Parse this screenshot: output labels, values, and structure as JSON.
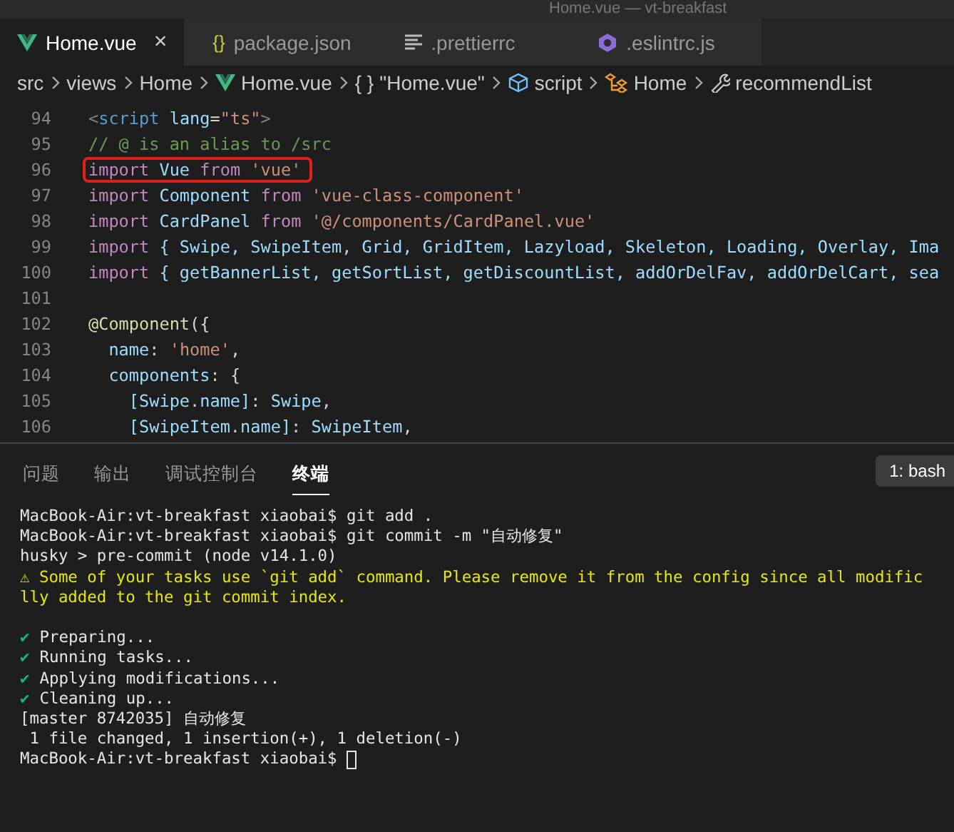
{
  "window": {
    "title": "Home.vue — vt-breakfast"
  },
  "tabs": [
    {
      "label": "Home.vue",
      "kind": "vue",
      "selected": true,
      "closable": true
    },
    {
      "label": "package.json",
      "kind": "json",
      "glyph": "{}",
      "selected": false
    },
    {
      "label": ".prettierrc",
      "kind": "lines",
      "selected": false
    },
    {
      "label": ".eslintrc.js",
      "kind": "eslint",
      "selected": false
    }
  ],
  "close_glyph": "×",
  "breadcrumb": [
    {
      "label": "src",
      "kind": "plain"
    },
    {
      "label": "views",
      "kind": "plain"
    },
    {
      "label": "Home",
      "kind": "plain"
    },
    {
      "label": "Home.vue",
      "kind": "vue"
    },
    {
      "label": "\"Home.vue\"",
      "kind": "braces",
      "glyph": "{ }"
    },
    {
      "label": "script",
      "kind": "cube"
    },
    {
      "label": "Home",
      "kind": "class"
    },
    {
      "label": "recommendList",
      "kind": "wrench"
    }
  ],
  "editor": {
    "lines": [
      {
        "number": "94",
        "tokens": [
          {
            "t": "<",
            "kind": "punct"
          },
          {
            "t": "script",
            "kind": "tag"
          },
          {
            "t": " lang",
            "kind": "attr"
          },
          {
            "t": "=",
            "kind": "plain"
          },
          {
            "t": "\"ts\"",
            "kind": "string"
          },
          {
            "t": ">",
            "kind": "punct"
          }
        ]
      },
      {
        "number": "95",
        "tokens": [
          {
            "t": "// @ is an alias to /src",
            "kind": "comment"
          }
        ]
      },
      {
        "number": "96",
        "highlighted": true,
        "tokens": [
          {
            "t": "import",
            "kind": "keyword"
          },
          {
            "t": " Vue ",
            "kind": "ident"
          },
          {
            "t": "from",
            "kind": "keyword"
          },
          {
            "t": " 'vue'",
            "kind": "string"
          }
        ]
      },
      {
        "number": "97",
        "tokens": [
          {
            "t": "import",
            "kind": "keyword"
          },
          {
            "t": " Component ",
            "kind": "ident"
          },
          {
            "t": "from",
            "kind": "keyword"
          },
          {
            "t": " 'vue-class-component'",
            "kind": "string"
          }
        ]
      },
      {
        "number": "98",
        "tokens": [
          {
            "t": "import",
            "kind": "keyword"
          },
          {
            "t": " CardPanel ",
            "kind": "ident"
          },
          {
            "t": "from",
            "kind": "keyword"
          },
          {
            "t": " '@/components/CardPanel.vue'",
            "kind": "string"
          }
        ]
      },
      {
        "number": "99",
        "tokens": [
          {
            "t": "import",
            "kind": "keyword"
          },
          {
            "t": " { Swipe, SwipeItem, Grid, GridItem, Lazyload, Skeleton, Loading, Overlay, Ima",
            "kind": "ident"
          }
        ]
      },
      {
        "number": "100",
        "tokens": [
          {
            "t": "import",
            "kind": "keyword"
          },
          {
            "t": " { getBannerList, getSortList, getDiscountList, addOrDelFav, addOrDelCart, sea",
            "kind": "ident"
          }
        ]
      },
      {
        "number": "101"
      },
      {
        "number": "102",
        "tokens": [
          {
            "t": "@Component",
            "kind": "decorator"
          },
          {
            "t": "({",
            "kind": "plain"
          }
        ]
      },
      {
        "number": "103",
        "tokens": [
          {
            "t": "  name",
            "kind": "ident"
          },
          {
            "t": ": ",
            "kind": "plain"
          },
          {
            "t": "'home'",
            "kind": "string"
          },
          {
            "t": ",",
            "kind": "plain"
          }
        ]
      },
      {
        "number": "104",
        "tokens": [
          {
            "t": "  components",
            "kind": "ident"
          },
          {
            "t": ": {",
            "kind": "plain"
          }
        ]
      },
      {
        "number": "105",
        "tokens": [
          {
            "t": "    [Swipe.name]",
            "kind": "ident"
          },
          {
            "t": ": ",
            "kind": "plain"
          },
          {
            "t": "Swipe",
            "kind": "ident"
          },
          {
            "t": ",",
            "kind": "plain"
          }
        ]
      },
      {
        "number": "106",
        "tokens": [
          {
            "t": "    [SwipeItem.name]",
            "kind": "ident"
          },
          {
            "t": ": ",
            "kind": "plain"
          },
          {
            "t": "SwipeItem",
            "kind": "ident"
          },
          {
            "t": ",",
            "kind": "plain"
          }
        ]
      }
    ]
  },
  "panel": {
    "tabs": [
      {
        "label": "问题",
        "selected": false
      },
      {
        "label": "输出",
        "selected": false
      },
      {
        "label": "调试控制台",
        "selected": false
      },
      {
        "label": "终端",
        "selected": true
      }
    ],
    "terminal_selector": "1: bash",
    "lines": [
      {
        "kind": "text",
        "text": "MacBook-Air:vt-breakfast xiaobai$ git add ."
      },
      {
        "kind": "text",
        "text": "MacBook-Air:vt-breakfast xiaobai$ git commit -m \"自动修复\""
      },
      {
        "kind": "text",
        "text": "husky > pre-commit (node v14.1.0)"
      },
      {
        "kind": "warning",
        "text": "⚠ Some of your tasks use `git add` command. Please remove it from the config since all modific"
      },
      {
        "kind": "warning",
        "text": "lly added to the git commit index."
      },
      {
        "kind": "blank"
      },
      {
        "kind": "check",
        "mark": "✔",
        "text": "Preparing..."
      },
      {
        "kind": "check",
        "mark": "✔",
        "text": "Running tasks..."
      },
      {
        "kind": "check",
        "mark": "✔",
        "text": "Applying modifications..."
      },
      {
        "kind": "check",
        "mark": "✔",
        "text": "Cleaning up..."
      },
      {
        "kind": "text",
        "text": "[master 8742035] 自动修复"
      },
      {
        "kind": "text",
        "text": " 1 file changed, 1 insertion(+), 1 deletion(-)"
      },
      {
        "kind": "text",
        "text": "MacBook-Air:vt-breakfast xiaobai$ ",
        "cursor": true
      }
    ]
  }
}
